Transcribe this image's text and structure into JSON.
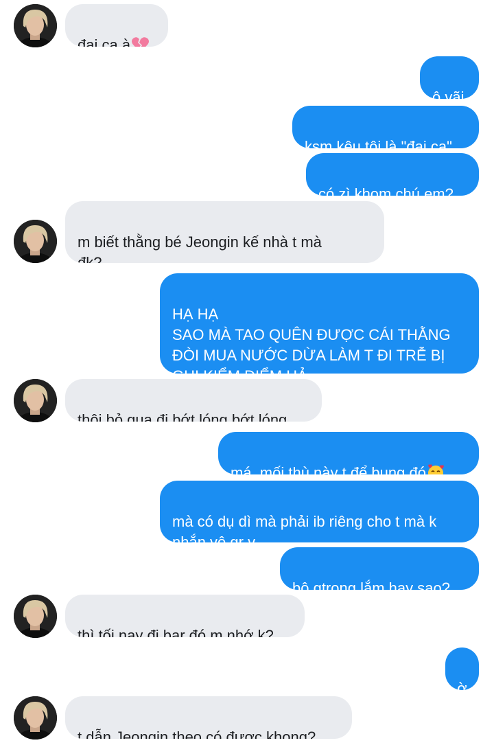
{
  "messages": [
    {
      "dir": "in",
      "text": "đại ca à",
      "emoji": "broken-heart-icon"
    },
    {
      "dir": "out",
      "text": "ô vãi"
    },
    {
      "dir": "out",
      "text": "ksm kêu tôi là \"đại ca\""
    },
    {
      "dir": "out",
      "text": "có zì khom chú em?"
    },
    {
      "dir": "in",
      "text": "m biết thằng bé Jeongin kế nhà t mà\nđk?"
    },
    {
      "dir": "out",
      "text": "HẠ HẠ\nSAO MÀ TAO QUÊN ĐƯỢC CÁI THẰNG\nĐÒI MUA NƯỚC DỪA LÀM T ĐI TRỄ BỊ\nGHI KIỂM ĐIỂM HẢ"
    },
    {
      "dir": "in",
      "text": "thôi bỏ qua đi bớt lóng bớt lóng"
    },
    {
      "dir": "out",
      "text": "má..mối thù này t để bụng đó",
      "emoji": "smiling-face-with-hearts-icon"
    },
    {
      "dir": "out",
      "text": "mà có dụ dì mà phải ib riêng cho t mà k\nnhắn vô gr v"
    },
    {
      "dir": "out",
      "text": "bộ qtrong lắm hay sao?"
    },
    {
      "dir": "in",
      "text": "thì tối nay đi bar đó m nhớ k?"
    },
    {
      "dir": "out",
      "text": "ờ"
    },
    {
      "dir": "in",
      "text": "t dẫn Jeongin theo có được khong?"
    }
  ],
  "colors": {
    "incoming_bubble": "#e9ebef",
    "outgoing_bubble": "#1b8ef2",
    "incoming_text": "#1c1e21",
    "outgoing_text": "#ffffff"
  }
}
